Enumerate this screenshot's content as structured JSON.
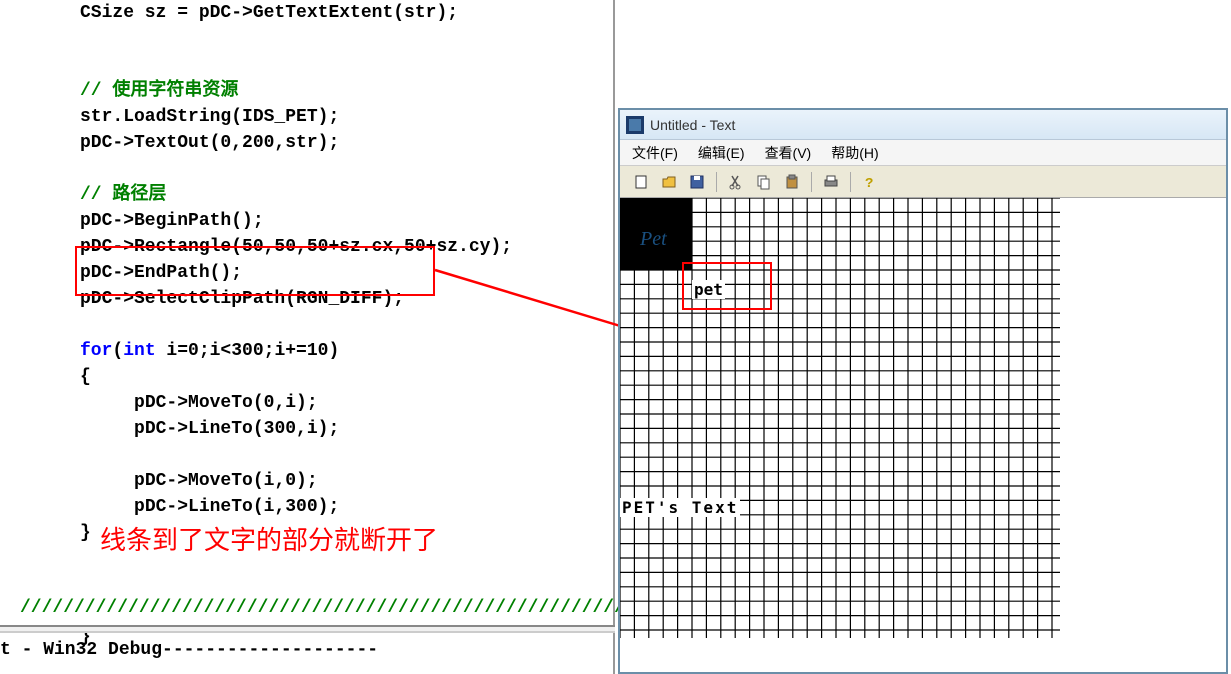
{
  "code": {
    "line1": "CSize sz = pDC->GetTextExtent(str);",
    "comment1": "// 使用字符串资源",
    "line2": "str.LoadString(IDS_PET);",
    "line3": "pDC->TextOut(0,200,str);",
    "comment2": "// 路径层",
    "line4": "pDC->BeginPath();",
    "line5": "pDC->Rectangle(50,50,50+sz.cx,50+sz.cy);",
    "line6": "pDC->EndPath();",
    "line7": "pDC->SelectClipPath(RGN_DIFF);",
    "for_kw": "for",
    "int_kw": "int",
    "line8_rest": " i=0;i<300;i+=10)",
    "line9": "{",
    "line10": "pDC->MoveTo(0,i);",
    "line11": "pDC->LineTo(300,i);",
    "line12": "pDC->MoveTo(i,0);",
    "line13": "pDC->LineTo(i,300);",
    "line14": "}",
    "line15": "}"
  },
  "annotation": "线条到了文字的部分就断开了",
  "hatch": "/////////////////////////////////////////////////////////////",
  "status": "t - Win32 Debug--------------------",
  "app": {
    "title": "Untitled - Text",
    "menu": {
      "file": "文件(F)",
      "edit": "编辑(E)",
      "view": "查看(V)",
      "help": "帮助(H)"
    },
    "canvas": {
      "pet_label": "pet",
      "pets_text": "PET's Text"
    },
    "toolbar_icons": {
      "new": "new-icon",
      "open": "open-icon",
      "save": "save-icon",
      "cut": "cut-icon",
      "copy": "copy-icon",
      "paste": "paste-icon",
      "print": "print-icon",
      "help": "help-icon"
    }
  }
}
